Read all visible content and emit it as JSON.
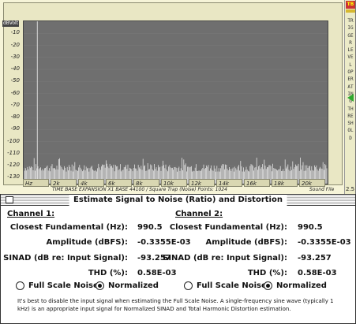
{
  "analyzer": {
    "unit_label": "dBVolt",
    "y_ticks": [
      "0",
      "-10",
      "-20",
      "-30",
      "-40",
      "-50",
      "-60",
      "-70",
      "-80",
      "-90",
      "-100",
      "-110",
      "-120",
      "-130"
    ],
    "x_ticks": [
      "Hz",
      "2k",
      "4k",
      "6k",
      "8k",
      "10k",
      "12k",
      "14k",
      "16k",
      "18k",
      "20k"
    ],
    "status_line": "TIME BASE EXPANSION X1   BASE 44100 / Square Trap (Noise)   Points: 1024",
    "sound_file": "Sound File",
    "trigger_top": "TB",
    "trigger_text": "TRIGGER LEVEL OPERATING THRESHOLD",
    "trigger_level": "2.5"
  },
  "chart_data": {
    "type": "line",
    "title": "",
    "xlabel": "Hz",
    "ylabel": "dBVolt",
    "xlim": [
      0,
      22050
    ],
    "ylim": [
      -135,
      0
    ],
    "noise_floor_db": -125,
    "noise_peak_db": -113,
    "fundamental_hz": 990.5,
    "fundamental_db": 0
  },
  "dialog": {
    "title": "Estimate Signal to Noise (Ratio) and Distortion",
    "channel1": {
      "heading": "Channel 1:",
      "fundamental_label": "Closest Fundamental (Hz):",
      "fundamental_value": "990.5",
      "amplitude_label": "Amplitude (dBFS):",
      "amplitude_value": "-0.3355E-03",
      "sinad_label": "SINAD (dB re: Input Signal):",
      "sinad_value": "-93.257",
      "thd_label": "THD (%):",
      "thd_value": "0.58E-03",
      "radio_full": "Full Scale Noise",
      "radio_norm": "Normalized"
    },
    "channel2": {
      "heading": "Channel 2:",
      "fundamental_label": "Closest Fundamental (Hz):",
      "fundamental_value": "990.5",
      "amplitude_label": "Amplitude (dBFS):",
      "amplitude_value": "-0.3355E-03",
      "sinad_label": "SINAD (dB re: Input Signal):",
      "sinad_value": "-93.257",
      "thd_label": "THD (%):",
      "thd_value": "0.58E-03",
      "radio_full": "Full Scale Noise",
      "radio_norm": "Normalized"
    },
    "help_text": "It's best to disable the input signal when estimating the Full Scale Noise.  A single-frequency sine wave (typically 1 kHz) is an appropriate input signal for Normalized SINAD and Total Harmonic Distortion estimation."
  }
}
